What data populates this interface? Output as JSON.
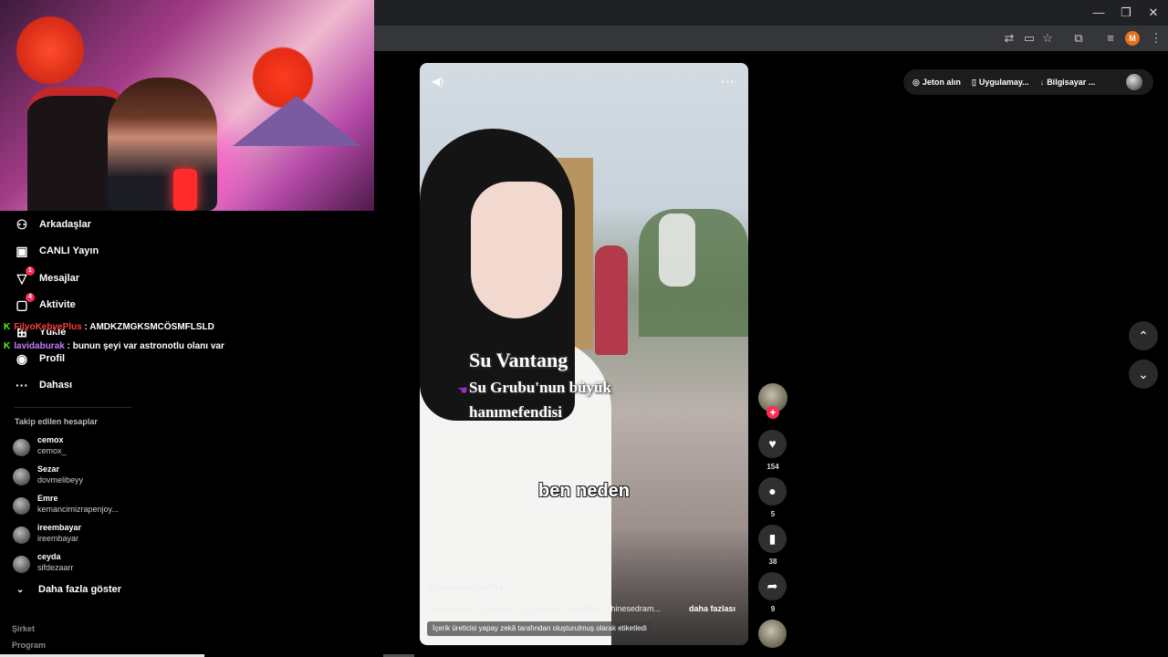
{
  "browser": {
    "window_controls": {
      "minimize": "—",
      "restore": "❐",
      "close": "✕"
    },
    "profile_initial": "M"
  },
  "sidebar": {
    "items": [
      {
        "label": "Arkadaşlar",
        "icon": "friends-icon"
      },
      {
        "label": "CANLI Yayın",
        "icon": "live-icon"
      },
      {
        "label": "Mesajlar",
        "icon": "messages-icon",
        "badge": "1"
      },
      {
        "label": "Aktivite",
        "icon": "activity-icon",
        "badge": "4"
      },
      {
        "label": "Yükle",
        "icon": "upload-icon"
      },
      {
        "label": "Profil",
        "icon": "profile-icon"
      },
      {
        "label": "Dahası",
        "icon": "more-icon"
      }
    ],
    "following_title": "Takip edilen hesaplar",
    "accounts": [
      {
        "name": "cemox",
        "username": "cemox_"
      },
      {
        "name": "Sezar",
        "username": "dovmelibeyy"
      },
      {
        "name": "Emre",
        "username": "kemancimizrapenjoy..."
      },
      {
        "name": "ireembayar",
        "username": "ireembayar"
      },
      {
        "name": "ceyda",
        "username": "sifdezaarr"
      }
    ],
    "show_more": "Daha fazla göster",
    "footer": [
      "Şirket",
      "Program"
    ]
  },
  "chat": [
    {
      "user": "FilyoKebyePlus",
      "message": ": AMDKZMGKSMCÖSMFLSLD"
    },
    {
      "user": "lavidaburak",
      "message": ": bunun şeyi var astronotlu olanı var"
    }
  ],
  "topbar": {
    "coins": "Jeton alın",
    "app": "Uygulamay...",
    "desktop": "Bilgisayar ..."
  },
  "video": {
    "title_line1": "Su Vantang",
    "title_line2": "Su Grubu'nun büyük",
    "title_line3": "hanımefendisi",
    "subtitle": "ben neden",
    "author": "drama.world044",
    "caption": "Yanılsamanın çiçeği part 1 iyi seyirler #shortfilm #chinesedram...",
    "caption_more": "daha fazlası",
    "ai_label": "İçerik üreticisi yapay zekâ tarafından oluşturulmuş olarak etiketledi"
  },
  "actions": {
    "follow": "+",
    "likes": "154",
    "comments": "5",
    "saves": "38",
    "shares": "9"
  },
  "navigation": {
    "up": "⌃",
    "down": "⌄"
  }
}
